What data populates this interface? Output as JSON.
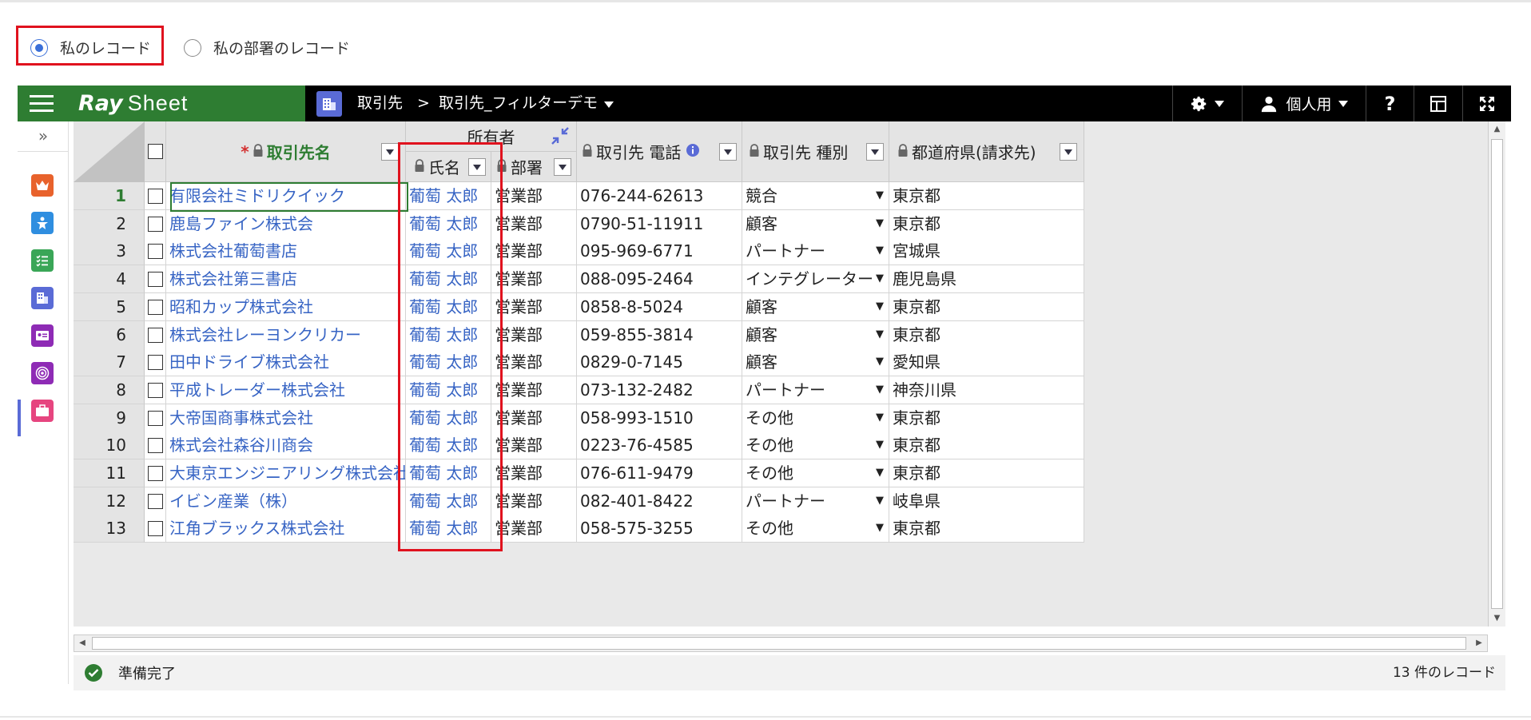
{
  "filter": {
    "options": [
      {
        "label": "私のレコード",
        "checked": true
      },
      {
        "label": "私の部署のレコード",
        "checked": false
      }
    ]
  },
  "header": {
    "logo_ray": "Ray",
    "logo_sheet": "Sheet",
    "crumb_object": "取引先",
    "crumb_separator": ">",
    "crumb_view": "取引先_フィルターデモ",
    "user_label": "個人用",
    "help_label": "?"
  },
  "table": {
    "group_header": "所有者",
    "columns": {
      "name": "取引先名",
      "owner_name": "氏名",
      "owner_dept": "部署",
      "phone": "取引先 電話",
      "type": "取引先 種別",
      "prefecture": "都道府県(請求先)"
    },
    "required_mark": "*",
    "rows": [
      {
        "no": "1",
        "name": "有限会社ミドリクイック",
        "owner": "葡萄 太郎",
        "dept": "営業部",
        "phone": "076-244-62613",
        "type": "競合",
        "pref": "東京都"
      },
      {
        "no": "2",
        "name": "鹿島ファイン株式会",
        "owner": "葡萄 太郎",
        "dept": "営業部",
        "phone": "0790-51-11911",
        "type": "顧客",
        "pref": "東京都"
      },
      {
        "no": "3",
        "name": "株式会社葡萄書店",
        "owner": "葡萄 太郎",
        "dept": "営業部",
        "phone": "095-969-6771",
        "type": "パートナー",
        "pref": "宮城県"
      },
      {
        "no": "4",
        "name": "株式会社第三書店",
        "owner": "葡萄 太郎",
        "dept": "営業部",
        "phone": "088-095-2464",
        "type": "インテグレーター",
        "pref": "鹿児島県"
      },
      {
        "no": "5",
        "name": "昭和カップ株式会社",
        "owner": "葡萄 太郎",
        "dept": "営業部",
        "phone": "0858-8-5024",
        "type": "顧客",
        "pref": "東京都"
      },
      {
        "no": "6",
        "name": "株式会社レーヨンクリカー",
        "owner": "葡萄 太郎",
        "dept": "営業部",
        "phone": "059-855-3814",
        "type": "顧客",
        "pref": "東京都"
      },
      {
        "no": "7",
        "name": "田中ドライブ株式会社",
        "owner": "葡萄 太郎",
        "dept": "営業部",
        "phone": "0829-0-7145",
        "type": "顧客",
        "pref": "愛知県"
      },
      {
        "no": "8",
        "name": "平成トレーダー株式会社",
        "owner": "葡萄 太郎",
        "dept": "営業部",
        "phone": "073-132-2482",
        "type": "パートナー",
        "pref": "神奈川県"
      },
      {
        "no": "9",
        "name": "大帝国商事株式会社",
        "owner": "葡萄 太郎",
        "dept": "営業部",
        "phone": "058-993-1510",
        "type": "その他",
        "pref": "東京都"
      },
      {
        "no": "10",
        "name": "株式会社森谷川商会",
        "owner": "葡萄 太郎",
        "dept": "営業部",
        "phone": "0223-76-4585",
        "type": "その他",
        "pref": "東京都"
      },
      {
        "no": "11",
        "name": "大東京エンジニアリング株式会社",
        "owner": "葡萄 太郎",
        "dept": "営業部",
        "phone": "076-611-9479",
        "type": "その他",
        "pref": "東京都"
      },
      {
        "no": "12",
        "name": "イビン産業（株）",
        "owner": "葡萄 太郎",
        "dept": "営業部",
        "phone": "082-401-8422",
        "type": "パートナー",
        "pref": "岐阜県"
      },
      {
        "no": "13",
        "name": "江角ブラックス株式会社",
        "owner": "葡萄 太郎",
        "dept": "営業部",
        "phone": "058-575-3255",
        "type": "その他",
        "pref": "東京都"
      }
    ]
  },
  "status": {
    "message": "準備完了",
    "record_count": "13 件のレコード"
  },
  "colors": {
    "brand_green": "#2e7d32",
    "link_blue": "#3764c4",
    "highlight_red": "#e0121e",
    "app_icon_blue": "#5a6bd6"
  },
  "nav_icons": [
    "crown-icon",
    "person-star-icon",
    "checklist-icon",
    "building-icon",
    "contact-card-icon",
    "target-icon",
    "briefcase-icon"
  ]
}
